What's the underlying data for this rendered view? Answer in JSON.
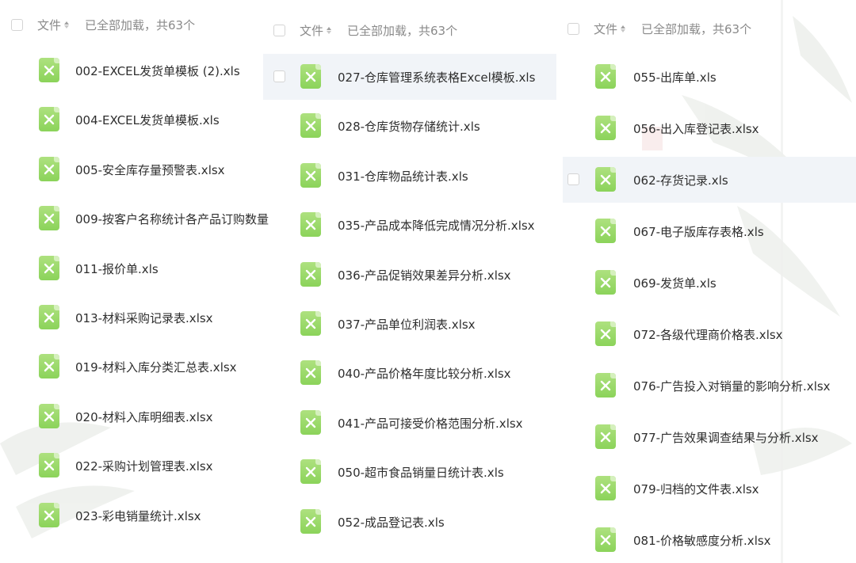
{
  "columns": [
    {
      "header": {
        "label": "文件",
        "status": "已全部加载，共63个"
      },
      "files": [
        "002-EXCEL发货单模板 (2).xls",
        "004-EXCEL发货单模板.xls",
        "005-安全库存量预警表.xlsx",
        "009-按客户名称统计各产品订购数量",
        "011-报价单.xls",
        "013-材料采购记录表.xlsx",
        "019-材料入库分类汇总表.xlsx",
        "020-材料入库明细表.xlsx",
        "022-采购计划管理表.xlsx",
        "023-彩电销量统计.xlsx"
      ]
    },
    {
      "header": {
        "label": "文件",
        "status": "已全部加载，共63个"
      },
      "files": [
        "027-仓库管理系统表格Excel模板.xls",
        "028-仓库货物存储统计.xls",
        "031-仓库物品统计表.xls",
        "035-产品成本降低完成情况分析.xlsx",
        "036-产品促销效果差异分析.xlsx",
        "037-产品单位利润表.xlsx",
        "040-产品价格年度比较分析.xlsx",
        "041-产品可接受价格范围分析.xlsx",
        "050-超市食品销量日统计表.xls",
        "052-成品登记表.xls"
      ]
    },
    {
      "header": {
        "label": "文件",
        "status": "已全部加载，共63个"
      },
      "files": [
        "055-出库单.xls",
        "056-出入库登记表.xlsx",
        "062-存货记录.xls",
        "067-电子版库存表格.xls",
        "069-发货单.xls",
        "072-各级代理商价格表.xlsx",
        "076-广告投入对销量的影响分析.xlsx",
        "077-广告效果调查结果与分析.xlsx",
        "079-归档的文件表.xlsx",
        "081-价格敏感度分析.xlsx"
      ]
    }
  ],
  "icon": "excel-file-icon",
  "colors": {
    "icon_green": "#8bd35a",
    "hover_row": "#f1f4f8"
  }
}
